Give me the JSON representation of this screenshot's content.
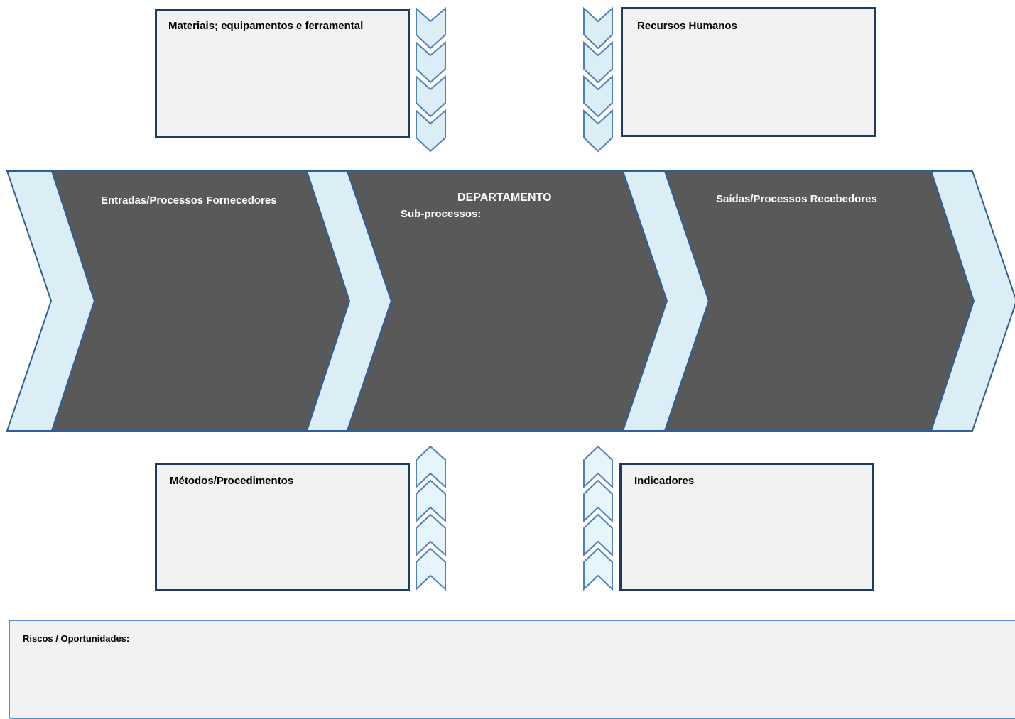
{
  "top_boxes": {
    "materials": "Materiais; equipamentos e ferramental",
    "human_resources": "Recursos Humanos"
  },
  "flow": {
    "inputs": "Entradas/Processos Fornecedores",
    "department_title": "DEPARTAMENTO",
    "subprocesses": "Sub-processos:",
    "outputs": "Saídas/Processos Recebedores"
  },
  "bottom_boxes": {
    "methods": "Métodos/Procedimentos",
    "indicators": "Indicadores"
  },
  "risks": {
    "label": "Riscos / Oportunidades:"
  },
  "colors": {
    "dark_fill": "#595959",
    "light_fill": "#dbeef6",
    "stroke": "#2e5f97",
    "box_border": "#1f3b5e",
    "box_fill": "#f2f2f2"
  }
}
